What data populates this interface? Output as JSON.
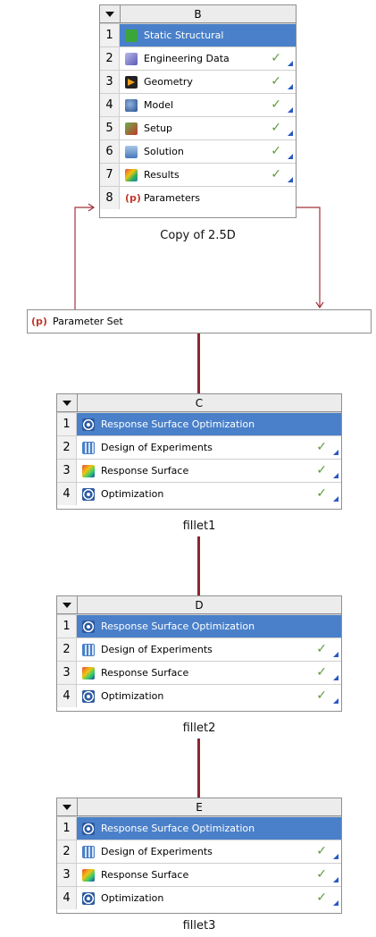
{
  "system_b": {
    "letter": "B",
    "caption": "Copy of 2.5D",
    "rows": [
      {
        "num": "1",
        "label": "Static Structural",
        "icon": "static-structural-icon",
        "check": ""
      },
      {
        "num": "2",
        "label": "Engineering Data",
        "icon": "engineering-data-icon",
        "check": "✓"
      },
      {
        "num": "3",
        "label": "Geometry",
        "icon": "geometry-icon",
        "check": "✓"
      },
      {
        "num": "4",
        "label": "Model",
        "icon": "model-icon",
        "check": "✓"
      },
      {
        "num": "5",
        "label": "Setup",
        "icon": "setup-icon",
        "check": "✓"
      },
      {
        "num": "6",
        "label": "Solution",
        "icon": "solution-icon",
        "check": "✓"
      },
      {
        "num": "7",
        "label": "Results",
        "icon": "results-icon",
        "check": "✓"
      },
      {
        "num": "8",
        "label": "Parameters",
        "icon": "parameters-icon",
        "check": ""
      }
    ]
  },
  "parameter_set": {
    "icon_text": "(p)",
    "label": "Parameter Set"
  },
  "system_c": {
    "letter": "C",
    "caption": "fillet1",
    "rows": [
      {
        "num": "1",
        "label": "Response Surface Optimization",
        "check": ""
      },
      {
        "num": "2",
        "label": "Design of Experiments",
        "check": "✓"
      },
      {
        "num": "3",
        "label": "Response Surface",
        "check": "✓"
      },
      {
        "num": "4",
        "label": "Optimization",
        "check": "✓"
      }
    ]
  },
  "system_d": {
    "letter": "D",
    "caption": "fillet2",
    "rows": [
      {
        "num": "1",
        "label": "Response Surface Optimization",
        "check": ""
      },
      {
        "num": "2",
        "label": "Design of Experiments",
        "check": "✓"
      },
      {
        "num": "3",
        "label": "Response Surface",
        "check": "✓"
      },
      {
        "num": "4",
        "label": "Optimization",
        "check": "✓"
      }
    ]
  },
  "system_e": {
    "letter": "E",
    "caption": "fillet3",
    "rows": [
      {
        "num": "1",
        "label": "Response Surface Optimization",
        "check": ""
      },
      {
        "num": "2",
        "label": "Design of Experiments",
        "check": "✓"
      },
      {
        "num": "3",
        "label": "Response Surface",
        "check": "✓"
      },
      {
        "num": "4",
        "label": "Optimization",
        "check": "✓"
      }
    ]
  },
  "colors": {
    "selected_row": "#4a80c9",
    "link": "#8b2630",
    "check": "#5e9a3a"
  }
}
